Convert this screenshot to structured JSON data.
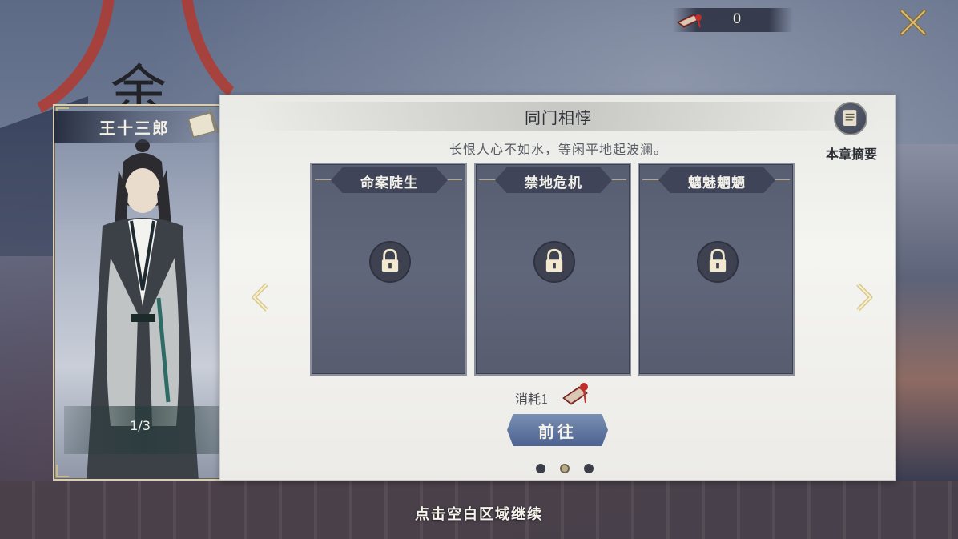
{
  "top_bar": {
    "currency_icon": "red-token-book-icon",
    "currency_value": "0",
    "close_icon": "close-x-icon"
  },
  "character": {
    "name": "王十三郎",
    "counter": "1/3",
    "scroll_icon": "scroll-icon"
  },
  "panel": {
    "title": "同门相悖",
    "subtitle": "长恨人心不如水，等闲平地起波澜。",
    "summary_label": "本章摘要",
    "summary_icon": "document-icon",
    "chapters": [
      {
        "label": "命案陡生",
        "locked": true
      },
      {
        "label": "禁地危机",
        "locked": true
      },
      {
        "label": "魑魅魍魉",
        "locked": true
      }
    ],
    "cost_label": "消耗1",
    "go_label": "前往",
    "page_dots": 3,
    "active_page": 2
  },
  "footer": {
    "continue_text": "点击空白区域继续"
  },
  "colors": {
    "panel_bg": "#f4f4f1",
    "card_bg": "#5d6376",
    "accent_gold": "#c9b98a",
    "button_blue": "#5a6f9c",
    "ribbon_red": "#b23a30"
  }
}
